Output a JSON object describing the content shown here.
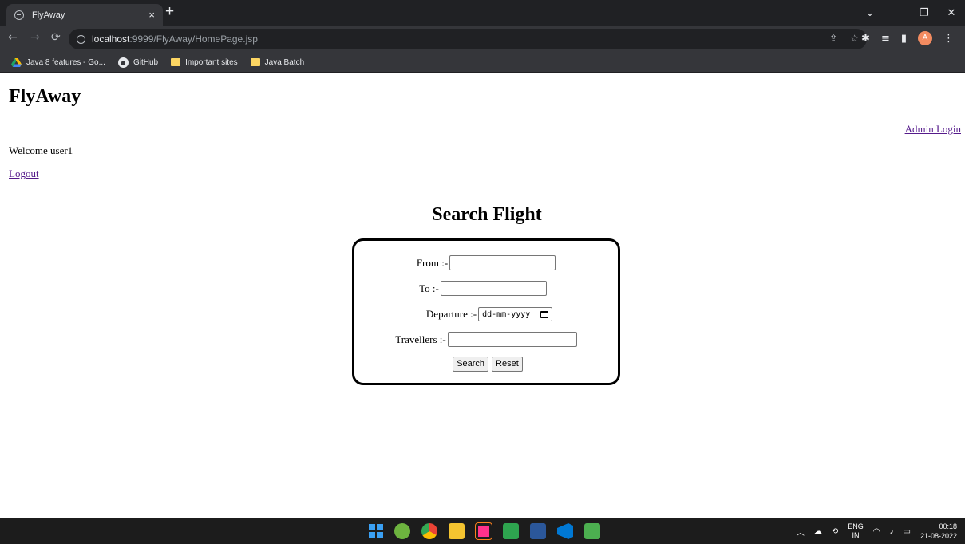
{
  "browser": {
    "tab_title": "FlyAway",
    "tab_close": "×",
    "new_tab": "+",
    "url_host": "localhost",
    "url_path": ":9999/FlyAway/HomePage.jsp",
    "profile_initial": "A",
    "window_controls": [
      "⌄",
      "—",
      "❐",
      "✕"
    ],
    "bookmarks": [
      {
        "label": "Java 8 features - Go...",
        "icon": "drive-icon"
      },
      {
        "label": "GitHub",
        "icon": "github-icon"
      },
      {
        "label": "Important sites",
        "icon": "folder-icon"
      },
      {
        "label": "Java Batch",
        "icon": "folder-icon"
      }
    ]
  },
  "page": {
    "brand": "FlyAway",
    "admin_login": "Admin Login",
    "welcome": "Welcome user1",
    "logout": "Logout",
    "search_title": "Search Flight",
    "form": {
      "from_label": "From :-",
      "to_label": "To :-",
      "departure_label": "Departure :-",
      "departure_placeholder": "dd-mm-yyyy",
      "travellers_label": "Travellers :-",
      "search_button": "Search",
      "reset_button": "Reset"
    }
  },
  "taskbar": {
    "lang_top": "ENG",
    "lang_bottom": "IN",
    "time": "00:18",
    "date": "21-08-2022"
  },
  "colors": {
    "link": "#551a8b",
    "chrome_dark": "#202124",
    "chrome_mid": "#35363a",
    "taskbar": "#1c1c1c"
  }
}
